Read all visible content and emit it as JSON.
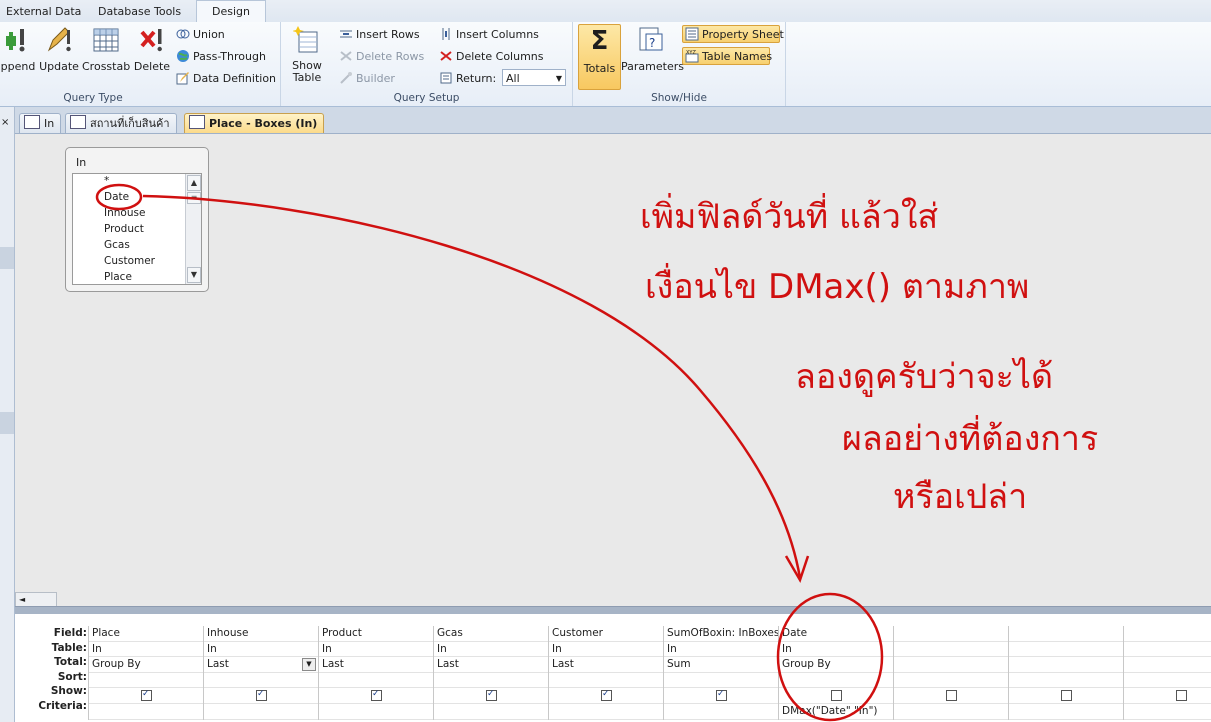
{
  "ribbon_tabs": [
    "External Data",
    "Database Tools",
    "Design"
  ],
  "query_type": {
    "label": "Query Type",
    "buttons": [
      "ppend",
      "Update",
      "Crosstab",
      "Delete"
    ],
    "small": [
      "Union",
      "Pass-Through",
      "Data Definition"
    ]
  },
  "query_setup": {
    "label": "Query Setup",
    "show_table": "Show Table",
    "col1": [
      "Insert Rows",
      "Delete Rows",
      "Builder"
    ],
    "col2": [
      "Insert Columns",
      "Delete Columns"
    ],
    "return_label": "Return:",
    "return_value": "All"
  },
  "show_hide": {
    "label": "Show/Hide",
    "totals": "Totals",
    "parameters": "Parameters",
    "property_sheet": "Property Sheet",
    "table_names": "Table Names"
  },
  "doc_tabs": [
    "In",
    "สถานที่เก็บสินค้า",
    "Place - Boxes (In)"
  ],
  "table_box": {
    "title": "In",
    "fields": [
      "*",
      "Date",
      "Inhouse",
      "Product",
      "Gcas",
      "Customer",
      "Place"
    ]
  },
  "grid": {
    "row_labels": [
      "Field:",
      "Table:",
      "Total:",
      "Sort:",
      "Show:",
      "Criteria:"
    ],
    "columns": [
      {
        "field": "Place",
        "table": "In",
        "total": "Group By",
        "show": true,
        "criteria": ""
      },
      {
        "field": "Inhouse",
        "table": "In",
        "total": "Last",
        "show": true,
        "criteria": ""
      },
      {
        "field": "Product",
        "table": "In",
        "total": "Last",
        "show": true,
        "criteria": ""
      },
      {
        "field": "Gcas",
        "table": "In",
        "total": "Last",
        "show": true,
        "criteria": ""
      },
      {
        "field": "Customer",
        "table": "In",
        "total": "Last",
        "show": true,
        "criteria": ""
      },
      {
        "field": "SumOfBoxin: InBoxes",
        "table": "In",
        "total": "Sum",
        "show": true,
        "criteria": ""
      },
      {
        "field": "Date",
        "table": "In",
        "total": "Group By",
        "show": false,
        "criteria": "DMax(\"Date\",\"In\")"
      },
      {
        "field": "",
        "table": "",
        "total": "",
        "show": false,
        "criteria": ""
      },
      {
        "field": "",
        "table": "",
        "total": "",
        "show": false,
        "criteria": ""
      },
      {
        "field": "",
        "table": "",
        "total": "",
        "show": false,
        "criteria": ""
      }
    ]
  },
  "annotation_lines": [
    "เพิ่มฟิลด์วันที่ แล้วใส่",
    "เงื่อนไข DMax() ตามภาพ",
    "ลองดูครับว่าจะได้",
    "ผลอย่างที่ต้องการ",
    "หรือเปล่า"
  ],
  "colors": {
    "annotation": "#d01010",
    "accent": "#f8c860"
  }
}
